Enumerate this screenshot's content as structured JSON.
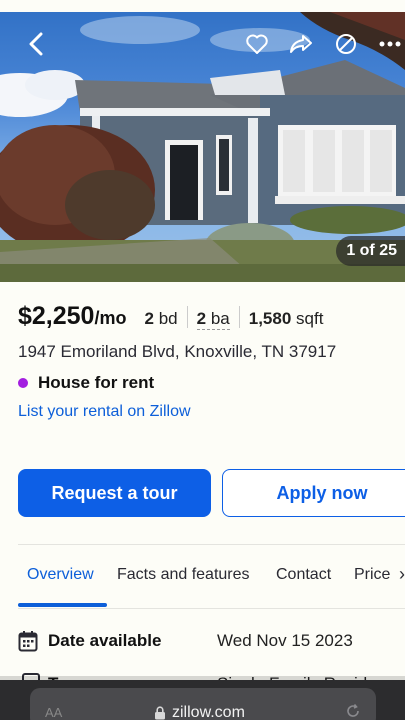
{
  "photo": {
    "counter": "1 of 25"
  },
  "listing": {
    "price": "$2,250",
    "price_unit": "/mo",
    "beds_num": "2",
    "beds_label": "bd",
    "baths_num": "2",
    "baths_label": "ba",
    "sqft_num": "1,580",
    "sqft_label": "sqft",
    "address": "1947 Emoriland Blvd, Knoxville, TN 37917",
    "status": "House for rent",
    "list_link": "List your rental on Zillow"
  },
  "actions": {
    "request_tour": "Request a tour",
    "apply_now": "Apply now"
  },
  "tabs": [
    "Overview",
    "Facts and features",
    "Contact",
    "Price"
  ],
  "facts": {
    "date_label": "Date available",
    "date_value": "Wed Nov 15 2023",
    "type_label": "Type",
    "type_value": "Single Family Residence"
  },
  "browser": {
    "aa_label": "AA",
    "url": "zillow.com"
  },
  "colors": {
    "accent": "#0d5fe6",
    "status_dot": "#a31ee0",
    "background": "#fdfdf7"
  },
  "icons": {
    "back": "chevron-left-icon",
    "save": "heart-icon",
    "share": "share-icon",
    "hide": "block-icon",
    "more": "more-icon",
    "calendar": "calendar-icon",
    "lock": "lock-icon",
    "reload": "reload-icon"
  }
}
